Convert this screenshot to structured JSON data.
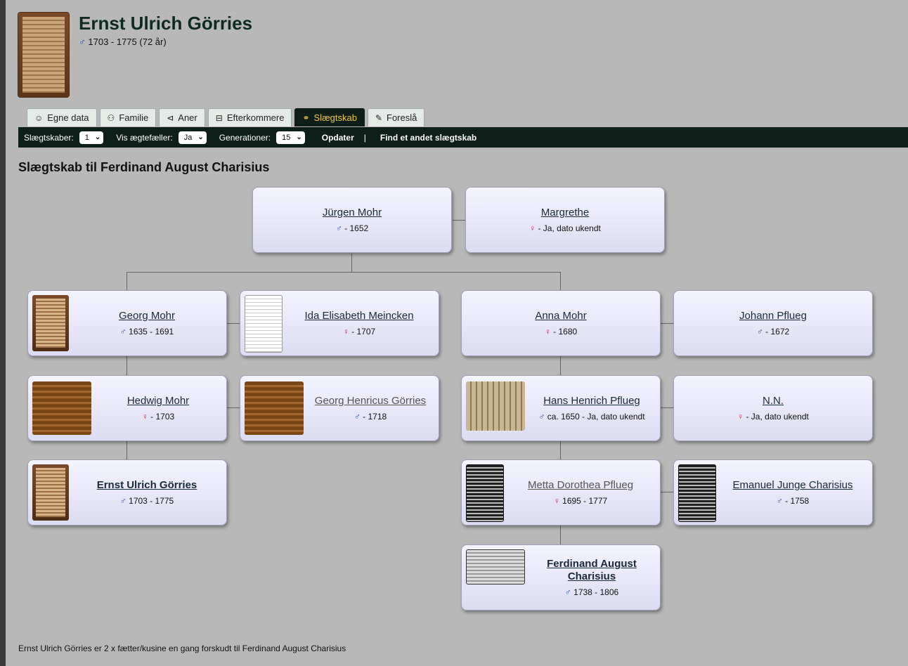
{
  "page": {
    "title": "Ernst Ulrich Görries",
    "sex_symbol": "♂",
    "life": "1703 - 1775  (72 år)"
  },
  "tabs": [
    {
      "label": "Egne data",
      "icon": "person-icon"
    },
    {
      "label": "Familie",
      "icon": "family-icon"
    },
    {
      "label": "Aner",
      "icon": "tree-icon"
    },
    {
      "label": "Efterkommere",
      "icon": "descendants-icon"
    },
    {
      "label": "Slægtskab",
      "icon": "relationship-icon"
    },
    {
      "label": "Foreslå",
      "icon": "suggest-icon"
    }
  ],
  "toolbar": {
    "slaegtskaber_label": "Slægtskaber:",
    "slaegtskaber_value": "1",
    "spouses_label": "Vis ægtefæller:",
    "spouses_value": "Ja",
    "generations_label": "Generationer:",
    "generations_value": "15",
    "update_label": "Opdater",
    "separator": "|",
    "find_label": "Find et andet slægtskab"
  },
  "section_title": "Slægtskab til Ferdinand August Charisius",
  "people": {
    "jurgen": {
      "name": "Jürgen Mohr",
      "sex": "♂",
      "dates": "- 1652"
    },
    "margrethe": {
      "name": "Margrethe",
      "sex": "♀",
      "dates": "- Ja, dato ukendt"
    },
    "georg": {
      "name": "Georg Mohr",
      "sex": "♂",
      "dates": "1635 - 1691"
    },
    "ida": {
      "name": "Ida Elisabeth Meincken",
      "sex": "♀",
      "dates": "- 1707"
    },
    "anna": {
      "name": "Anna Mohr",
      "sex": "♀",
      "dates": "- 1680"
    },
    "johann": {
      "name": "Johann Pflueg",
      "sex": "♂",
      "dates": "- 1672"
    },
    "hedwig": {
      "name": "Hedwig Mohr",
      "sex": "♀",
      "dates": "- 1703"
    },
    "georg_henricus": {
      "name": "Georg Henricus Görries",
      "sex": "♂",
      "dates": "- 1718"
    },
    "hans": {
      "name": "Hans Henrich Pflueg",
      "sex": "♂",
      "dates": "ca. 1650 - Ja, dato ukendt"
    },
    "nn": {
      "name": "N.N.",
      "sex": "♀",
      "dates": "- Ja, dato ukendt"
    },
    "ernst": {
      "name": "Ernst Ulrich Görries",
      "sex": "♂",
      "dates": "1703 - 1775"
    },
    "metta": {
      "name": "Metta Dorothea Pflueg",
      "sex": "♀",
      "dates": "1695 - 1777"
    },
    "emanuel": {
      "name": "Emanuel Junge Charisius",
      "sex": "♂",
      "dates": "- 1758"
    },
    "ferdinand": {
      "name": "Ferdinand August Charisius",
      "sex": "♂",
      "dates": "1738 - 1806"
    }
  },
  "footer": "Ernst Ulrich Görries er 2 x fætter/kusine en gang forskudt til Ferdinand August Charisius",
  "colors": {
    "male": "#2a4ab5",
    "female": "#cc2240",
    "toolbar_bg": "#0e1f19",
    "active_tab_text": "#f0c542"
  }
}
